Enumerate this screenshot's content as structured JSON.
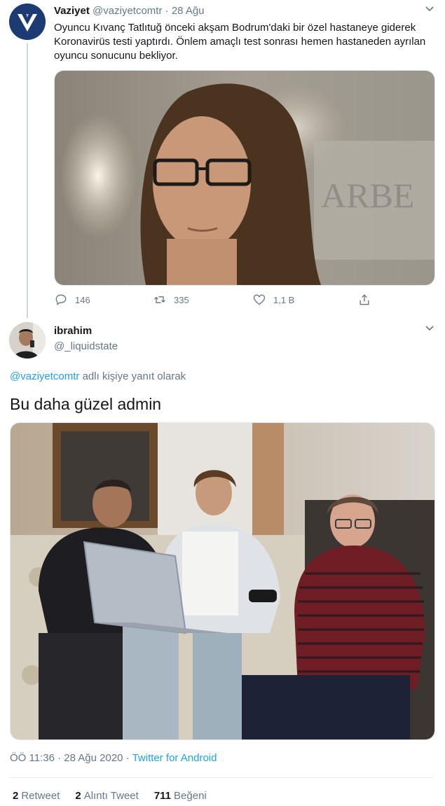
{
  "tweet1": {
    "name": "Vaziyet",
    "handle": "@vaziyetcomtr",
    "separator": "·",
    "date": "28 Ağu",
    "body": "Oyuncu Kıvanç Tatlıtuğ önceki akşam Bodrum'daki bir özel hastaneye giderek Koronavirüs testi yaptırdı. Önlem amaçlı test sonrası hemen hastaneden ayrılan oyuncu sonucunu bekliyor.",
    "actions": {
      "reply_count": "146",
      "retweet_count": "335",
      "like_count": "1,1 B"
    },
    "icons": {
      "avatar": "vaziyet-logo",
      "reply": "reply-icon",
      "retweet": "retweet-icon",
      "like": "heart-icon",
      "share": "share-icon",
      "more": "chevron-down-icon"
    }
  },
  "tweet2": {
    "name": "ibrahim",
    "handle": "@_liquidstate",
    "replying_prefix": "",
    "replying_handle": "@vaziyetcomtr",
    "replying_suffix": " adlı kişiye yanıt olarak",
    "text": "Bu daha güzel admin",
    "meta": {
      "time": "ÖÖ 11:36 · 28 Ağu 2020 · ",
      "source": "Twitter for Android"
    },
    "stats": {
      "retweets_count": "2",
      "retweets_label": "Retweet",
      "quotes_count": "2",
      "quotes_label": "Alıntı Tweet",
      "likes_count": "711",
      "likes_label": "Beğeni"
    }
  },
  "colors": {
    "accent": "#1da1f2",
    "secondary_text": "#657786",
    "primary_text": "#14171a",
    "border": "#e1e8ed"
  }
}
